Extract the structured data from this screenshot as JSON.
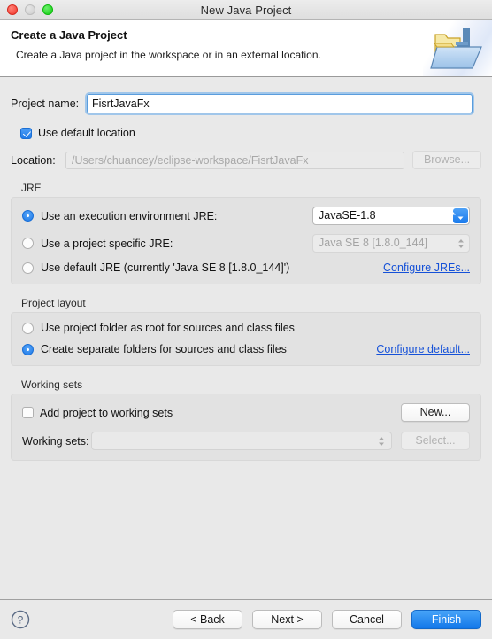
{
  "window": {
    "title": "New Java Project",
    "traffic_lights": [
      "close-red",
      "minimize-gray",
      "zoom-green"
    ]
  },
  "header": {
    "title": "Create a Java Project",
    "description": "Create a Java project in the workspace or in an external location.",
    "icon": "java-project-folder-icon"
  },
  "form": {
    "project_name_label": "Project name:",
    "project_name_value": "FisrtJavaFx",
    "use_default_location_label": "Use default location",
    "use_default_location_checked": true,
    "location_label": "Location:",
    "location_placeholder": "/Users/chuancey/eclipse-workspace/FisrtJavaFx",
    "browse_label": "Browse..."
  },
  "jre": {
    "group_title": "JRE",
    "options": [
      {
        "label": "Use an execution environment JRE:",
        "selected": true
      },
      {
        "label": "Use a project specific JRE:",
        "selected": false
      },
      {
        "label": "Use default JRE (currently 'Java SE 8 [1.8.0_144]')",
        "selected": false
      }
    ],
    "execution_env_value": "JavaSE-1.8",
    "project_jre_value": "Java SE 8 [1.8.0_144]",
    "configure_link": "Configure JREs..."
  },
  "project_layout": {
    "group_title": "Project layout",
    "options": [
      {
        "label": "Use project folder as root for sources and class files",
        "selected": false
      },
      {
        "label": "Create separate folders for sources and class files",
        "selected": true
      }
    ],
    "configure_link": "Configure default..."
  },
  "working_sets": {
    "group_title": "Working sets",
    "add_label": "Add project to working sets",
    "add_checked": false,
    "new_label": "New...",
    "working_sets_label": "Working sets:",
    "working_sets_value": "",
    "select_label": "Select..."
  },
  "footer": {
    "help_icon": "help-question-icon",
    "back_label": "< Back",
    "next_label": "Next >",
    "cancel_label": "Cancel",
    "finish_label": "Finish"
  },
  "colors": {
    "accent_blue": "#1f7ae8",
    "link_blue": "#1551d8",
    "window_bg": "#e9e9e9",
    "group_bg": "#e2e2e2"
  }
}
